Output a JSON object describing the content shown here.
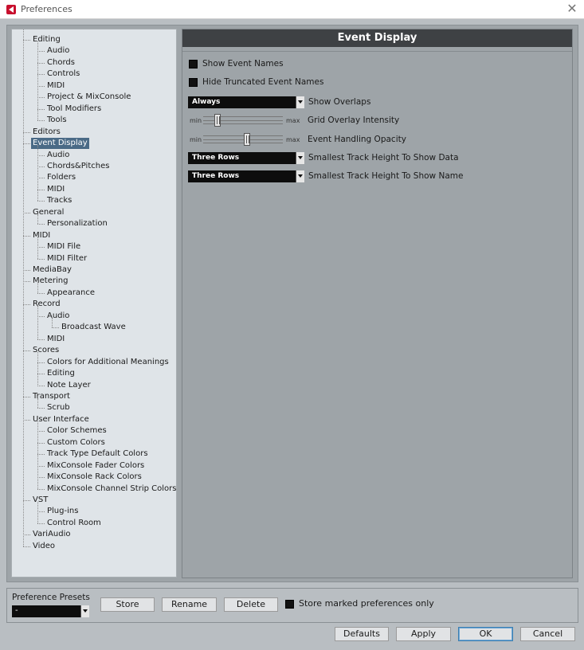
{
  "window": {
    "title": "Preferences",
    "close_glyph": "✕"
  },
  "tree": {
    "items": [
      {
        "label": "Editing",
        "level": 0
      },
      {
        "label": "Audio",
        "level": 1
      },
      {
        "label": "Chords",
        "level": 1
      },
      {
        "label": "Controls",
        "level": 1
      },
      {
        "label": "MIDI",
        "level": 1
      },
      {
        "label": "Project & MixConsole",
        "level": 1
      },
      {
        "label": "Tool Modifiers",
        "level": 1
      },
      {
        "label": "Tools",
        "level": 1
      },
      {
        "label": "Editors",
        "level": 0
      },
      {
        "label": "Event Display",
        "level": 0,
        "selected": true
      },
      {
        "label": "Audio",
        "level": 1
      },
      {
        "label": "Chords&Pitches",
        "level": 1
      },
      {
        "label": "Folders",
        "level": 1
      },
      {
        "label": "MIDI",
        "level": 1
      },
      {
        "label": "Tracks",
        "level": 1
      },
      {
        "label": "General",
        "level": 0
      },
      {
        "label": "Personalization",
        "level": 1
      },
      {
        "label": "MIDI",
        "level": 0
      },
      {
        "label": "MIDI File",
        "level": 1
      },
      {
        "label": "MIDI Filter",
        "level": 1
      },
      {
        "label": "MediaBay",
        "level": 0
      },
      {
        "label": "Metering",
        "level": 0
      },
      {
        "label": "Appearance",
        "level": 1
      },
      {
        "label": "Record",
        "level": 0
      },
      {
        "label": "Audio",
        "level": 1
      },
      {
        "label": "Broadcast Wave",
        "level": 2
      },
      {
        "label": "MIDI",
        "level": 1
      },
      {
        "label": "Scores",
        "level": 0
      },
      {
        "label": "Colors for Additional Meanings",
        "level": 1
      },
      {
        "label": "Editing",
        "level": 1
      },
      {
        "label": "Note Layer",
        "level": 1
      },
      {
        "label": "Transport",
        "level": 0
      },
      {
        "label": "Scrub",
        "level": 1
      },
      {
        "label": "User Interface",
        "level": 0
      },
      {
        "label": "Color Schemes",
        "level": 1
      },
      {
        "label": "Custom Colors",
        "level": 1
      },
      {
        "label": "Track Type Default Colors",
        "level": 1
      },
      {
        "label": "MixConsole Fader Colors",
        "level": 1
      },
      {
        "label": "MixConsole Rack Colors",
        "level": 1
      },
      {
        "label": "MixConsole Channel Strip Colors",
        "level": 1
      },
      {
        "label": "VST",
        "level": 0
      },
      {
        "label": "Plug-ins",
        "level": 1
      },
      {
        "label": "Control Room",
        "level": 1
      },
      {
        "label": "VariAudio",
        "level": 0
      },
      {
        "label": "Video",
        "level": 0
      }
    ]
  },
  "panel": {
    "title": "Event Display",
    "show_event_names": "Show Event Names",
    "hide_truncated": "Hide Truncated Event Names",
    "show_overlaps": {
      "value": "Always",
      "label": "Show Overlaps"
    },
    "grid_overlay": {
      "min": "min",
      "max": "max",
      "label": "Grid Overlay Intensity",
      "level": 0.15
    },
    "event_handling": {
      "min": "min",
      "max": "max",
      "label": "Event Handling Opacity",
      "level": 0.55
    },
    "track_height_data": {
      "value": "Three Rows",
      "label": "Smallest Track Height To Show Data"
    },
    "track_height_name": {
      "value": "Three Rows",
      "label": "Smallest Track Height To Show Name"
    }
  },
  "footer": {
    "presets_label": "Preference Presets",
    "presets_value": "-",
    "store": "Store",
    "rename": "Rename",
    "delete": "Delete",
    "store_marked": "Store marked preferences only",
    "defaults": "Defaults",
    "apply": "Apply",
    "ok": "OK",
    "cancel": "Cancel"
  },
  "colors": {
    "selected_bg": "#4a6a86",
    "header_bg": "#3e4144",
    "panel_bg": "#9ea4a8",
    "tree_bg": "#dfe4e8"
  }
}
